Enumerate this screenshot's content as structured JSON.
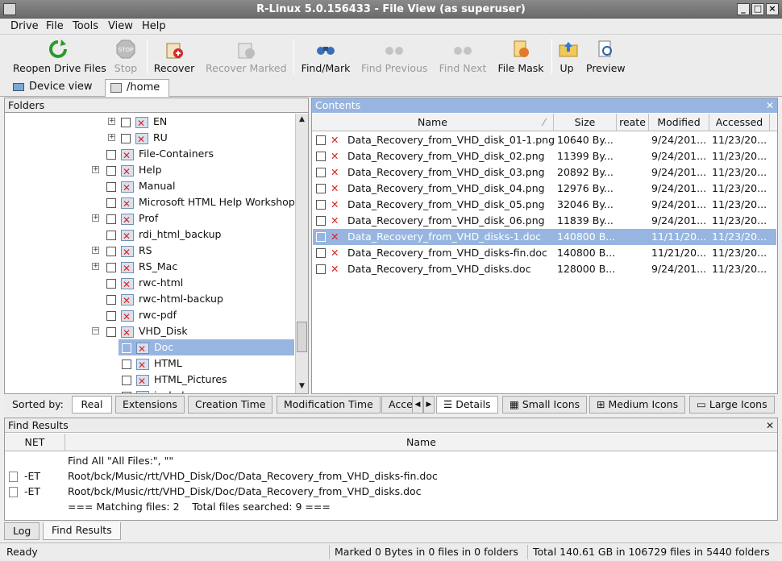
{
  "window": {
    "title": "R-Linux 5.0.156433 - File View (as superuser)"
  },
  "menu": [
    "Drive",
    "File",
    "Tools",
    "View",
    "Help"
  ],
  "toolbar": {
    "reopen": "Reopen Drive Files",
    "stop": "Stop",
    "recover": "Recover",
    "recover_marked": "Recover Marked",
    "find_mark": "Find/Mark",
    "find_previous": "Find Previous",
    "find_next": "Find Next",
    "file_mask": "File Mask",
    "up": "Up",
    "preview": "Preview"
  },
  "tabs": {
    "device_view": "Device view",
    "home": "/home"
  },
  "folders": {
    "title": "Folders",
    "items": [
      "EN",
      "RU",
      "File-Containers",
      "Help",
      "Manual",
      "Microsoft HTML Help Workshop",
      "Prof",
      "rdi_html_backup",
      "RS",
      "RS_Mac",
      "rwc-html",
      "rwc-html-backup",
      "rwc-pdf",
      "VHD_Disk",
      "Doc",
      "HTML",
      "HTML_Pictures",
      "include"
    ]
  },
  "contents": {
    "title": "Contents",
    "columns": {
      "name": "Name",
      "size": "Size",
      "created": "reate",
      "modified": "Modified",
      "accessed": "Accessed"
    },
    "rows": [
      {
        "name": "Data_Recovery_from_VHD_disk_01-1.png",
        "size": "10640 By...",
        "modified": "9/24/201...",
        "accessed": "11/23/20..."
      },
      {
        "name": "Data_Recovery_from_VHD_disk_02.png",
        "size": "11399 By...",
        "modified": "9/24/201...",
        "accessed": "11/23/20..."
      },
      {
        "name": "Data_Recovery_from_VHD_disk_03.png",
        "size": "20892 By...",
        "modified": "9/24/201...",
        "accessed": "11/23/20..."
      },
      {
        "name": "Data_Recovery_from_VHD_disk_04.png",
        "size": "12976 By...",
        "modified": "9/24/201...",
        "accessed": "11/23/20..."
      },
      {
        "name": "Data_Recovery_from_VHD_disk_05.png",
        "size": "32046 By...",
        "modified": "9/24/201...",
        "accessed": "11/23/20..."
      },
      {
        "name": "Data_Recovery_from_VHD_disk_06.png",
        "size": "11839 By...",
        "modified": "9/24/201...",
        "accessed": "11/23/20..."
      },
      {
        "name": "Data_Recovery_from_VHD_disks-1.doc",
        "size": "140800 B...",
        "modified": "11/11/20...",
        "accessed": "11/23/20..."
      },
      {
        "name": "Data_Recovery_from_VHD_disks-fin.doc",
        "size": "140800 B...",
        "modified": "11/21/20...",
        "accessed": "11/23/20..."
      },
      {
        "name": "Data_Recovery_from_VHD_disks.doc",
        "size": "128000 B...",
        "modified": "9/24/201...",
        "accessed": "11/23/20..."
      }
    ]
  },
  "sortbar": {
    "label": "Sorted by:",
    "real": "Real",
    "extensions": "Extensions",
    "creation_time": "Creation Time",
    "modification_time": "Modification Time",
    "access": "Acce",
    "details": "Details",
    "small_icons": "Small Icons",
    "medium_icons": "Medium Icons",
    "large_icons": "Large Icons"
  },
  "find_results": {
    "title": "Find Results",
    "columns": {
      "net": "NET",
      "name": "Name"
    },
    "header_line": "Find All \"All Files:\", \"\"",
    "rows": [
      {
        "net": "-ET",
        "path": "Root/bck/Music/rtt/VHD_Disk/Doc/Data_Recovery_from_VHD_disks-fin.doc"
      },
      {
        "net": "-ET",
        "path": "Root/bck/Music/rtt/VHD_Disk/Doc/Data_Recovery_from_VHD_disks.doc"
      }
    ],
    "summary": "=== Matching files: 2    Total files searched: 9 ==="
  },
  "bottom_tabs": {
    "log": "Log",
    "find_results": "Find Results"
  },
  "status": {
    "ready": "Ready",
    "marked": "Marked 0 Bytes in 0 files in 0 folders",
    "total": "Total 140.61 GB in 106729 files in 5440 folders"
  }
}
